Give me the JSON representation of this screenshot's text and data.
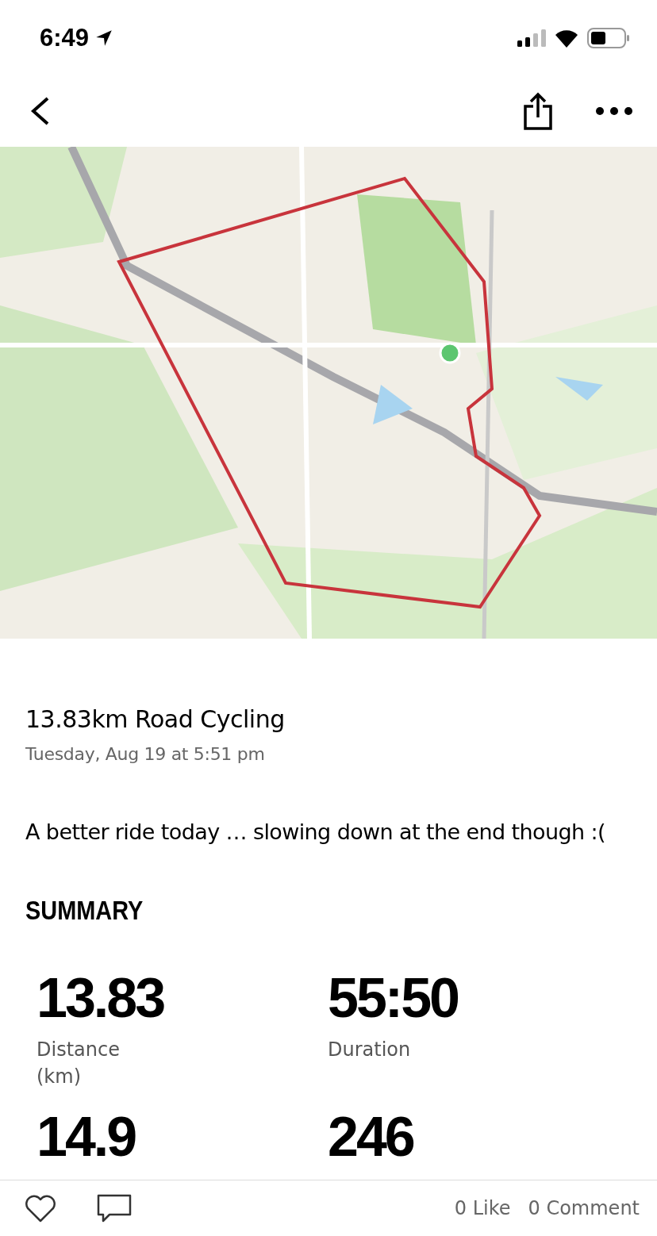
{
  "status_bar": {
    "time": "6:49"
  },
  "activity": {
    "title": "13.83km Road Cycling",
    "date": "Tuesday, Aug 19 at 5:51 pm",
    "description": "A better ride today … slowing down at the end though :("
  },
  "summary": {
    "heading": "SUMMARY",
    "stats": [
      {
        "value": "13.83",
        "label": "Distance (km)"
      },
      {
        "value": "55:50",
        "label": "Duration"
      },
      {
        "value": "14.9"
      },
      {
        "value": "246"
      }
    ]
  },
  "footer": {
    "likes": "0 Like",
    "comments": "0 Comment"
  }
}
